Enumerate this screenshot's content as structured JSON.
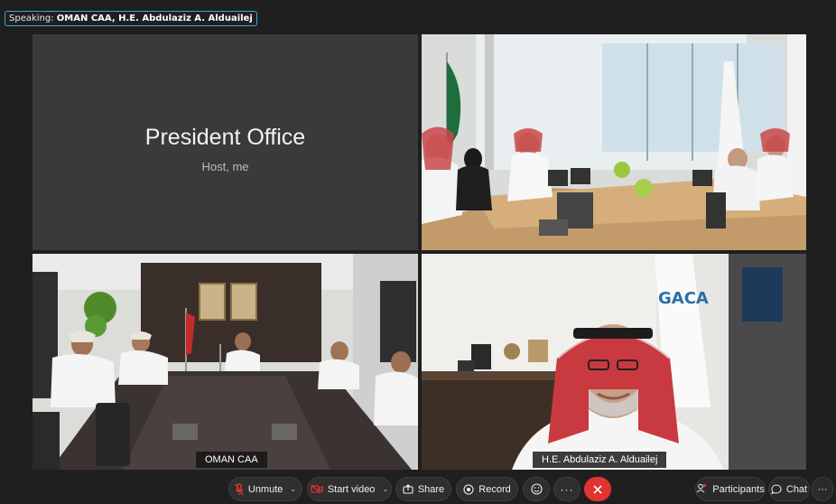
{
  "speaking_bar": {
    "prefix": "Speaking:",
    "names": "OMAN CAA, H.E. Abdulaziz A. Alduailej"
  },
  "tiles": {
    "president": {
      "name": "President Office",
      "role": "Host, me"
    },
    "oman": {
      "name": "OMAN CAA"
    },
    "speaker": {
      "name": "H.E. Abdulaziz A. Alduailej"
    }
  },
  "toolbar": {
    "unmute": "Unmute",
    "start_video": "Start video",
    "share": "Share",
    "record": "Record",
    "participants": "Participants",
    "chat": "Chat"
  },
  "icons": {
    "mic_muted": "mic-muted-icon",
    "video_off": "video-off-icon",
    "share": "share-icon",
    "record": "record-icon",
    "reactions": "smiley-icon",
    "more": "more-icon",
    "leave": "close-icon",
    "participants": "people-icon",
    "chat": "chat-icon"
  },
  "colors": {
    "active_border": "#35a9dc",
    "leave": "#e1332f",
    "muted_icon": "#e1332f",
    "notification": "#e1332f"
  }
}
